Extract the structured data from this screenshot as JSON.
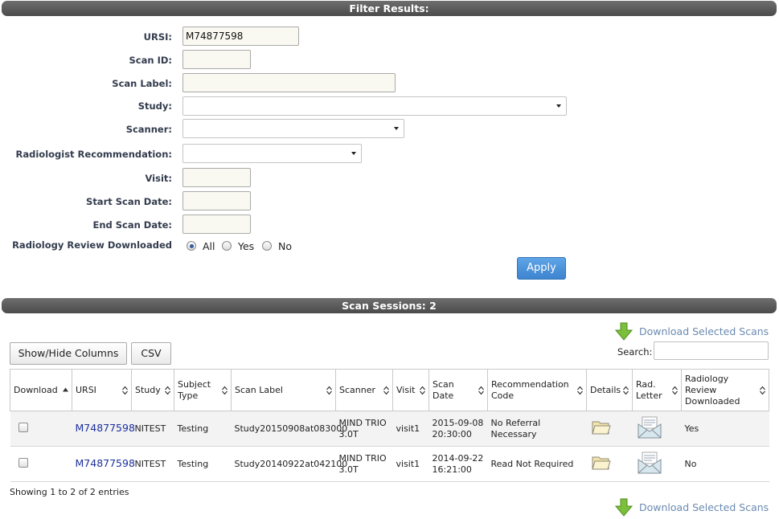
{
  "filter": {
    "title": "Filter Results:",
    "fields": {
      "ursi": {
        "label": "URSI:",
        "value": "M74877598"
      },
      "scan_id": {
        "label": "Scan ID:",
        "value": ""
      },
      "scan_label": {
        "label": "Scan Label:",
        "value": ""
      },
      "study": {
        "label": "Study:",
        "value": ""
      },
      "scanner": {
        "label": "Scanner:",
        "value": ""
      },
      "radiologist_recommendation": {
        "label": "Radiologist Recommendation:",
        "value": ""
      },
      "visit": {
        "label": "Visit:",
        "value": ""
      },
      "start_scan_date": {
        "label": "Start Scan Date:",
        "value": ""
      },
      "end_scan_date": {
        "label": "End Scan Date:",
        "value": ""
      }
    },
    "radiology_review": {
      "label": "Radiology Review Downloaded",
      "options": [
        "All",
        "Yes",
        "No"
      ],
      "selected": "All"
    },
    "apply_label": "Apply"
  },
  "sessions": {
    "title": "Scan Sessions: 2",
    "download_selected_label": "Download Selected Scans",
    "show_hide_label": "Show/Hide Columns",
    "csv_label": "CSV",
    "search_label": "Search:",
    "search_value": "",
    "columns": [
      "Download",
      "URSI",
      "Study",
      "Subject Type",
      "Scan Label",
      "Scanner",
      "Visit",
      "Scan Date",
      "Recommendation Code",
      "Details",
      "Rad. Letter",
      "Radiology Review Downloaded"
    ],
    "rows": [
      {
        "ursi": "M74877598",
        "study": "NITEST",
        "subject_type": "Testing",
        "scan_label": "Study20150908at083000",
        "scanner": "MIND TRIO 3.0T",
        "visit": "visit1",
        "scan_date": "2015-09-08 20:30:00",
        "recommendation_code": "No Referral Necessary",
        "details_icon": "folder-icon",
        "letter_icon": "envelope-icon",
        "review_downloaded": "Yes"
      },
      {
        "ursi": "M74877598",
        "study": "NITEST",
        "subject_type": "Testing",
        "scan_label": "Study20140922at042100",
        "scanner": "MIND TRIO 3.0T",
        "visit": "visit1",
        "scan_date": "2014-09-22 16:21:00",
        "recommendation_code": "Read Not Required",
        "details_icon": "folder-icon",
        "letter_icon": "envelope-icon",
        "review_downloaded": "No"
      }
    ],
    "info": "Showing 1 to 2 of 2 entries"
  },
  "colors": {
    "header_bar": "#5c5c5c",
    "apply_button": "#4a90d9",
    "link": "#1c2f9e",
    "download_link": "#6a8ab0",
    "download_arrow": "#7cbf3a"
  }
}
